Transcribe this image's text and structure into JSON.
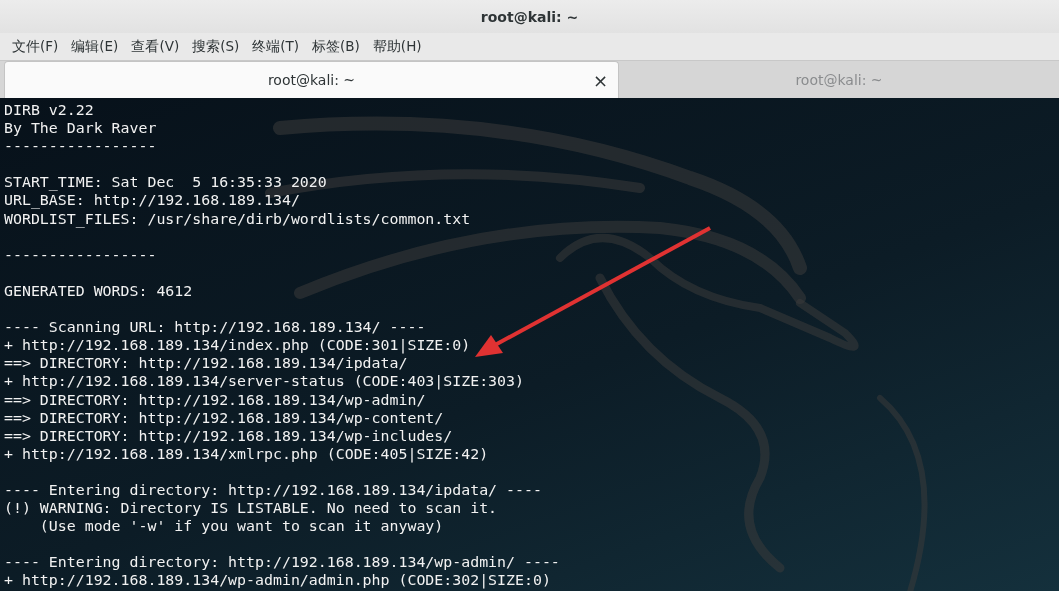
{
  "window": {
    "title": "root@kali: ~"
  },
  "menu": [
    "文件(F)",
    "编辑(E)",
    "查看(V)",
    "搜索(S)",
    "终端(T)",
    "标签(B)",
    "帮助(H)"
  ],
  "tabs": [
    {
      "label": "root@kali: ~",
      "selected": true,
      "close": "×"
    },
    {
      "label": "root@kali: ~",
      "selected": false
    }
  ],
  "terminal": {
    "blocks": [
      [
        "DIRB v2.22",
        "By The Dark Raver",
        "-----------------"
      ],
      [
        "START_TIME: Sat Dec  5 16:35:33 2020",
        "URL_BASE: http://192.168.189.134/",
        "WORDLIST_FILES: /usr/share/dirb/wordlists/common.txt"
      ],
      [
        "-----------------"
      ],
      [
        "GENERATED WORDS: 4612"
      ],
      [
        "---- Scanning URL: http://192.168.189.134/ ----",
        "+ http://192.168.189.134/index.php (CODE:301|SIZE:0)",
        "==> DIRECTORY: http://192.168.189.134/ipdata/",
        "+ http://192.168.189.134/server-status (CODE:403|SIZE:303)",
        "==> DIRECTORY: http://192.168.189.134/wp-admin/",
        "==> DIRECTORY: http://192.168.189.134/wp-content/",
        "==> DIRECTORY: http://192.168.189.134/wp-includes/",
        "+ http://192.168.189.134/xmlrpc.php (CODE:405|SIZE:42)"
      ],
      [
        "---- Entering directory: http://192.168.189.134/ipdata/ ----",
        "(!) WARNING: Directory IS LISTABLE. No need to scan it.",
        "    (Use mode '-w' if you want to scan it anyway)"
      ],
      [
        "---- Entering directory: http://192.168.189.134/wp-admin/ ----",
        "+ http://192.168.189.134/wp-admin/admin.php (CODE:302|SIZE:0)"
      ]
    ]
  }
}
